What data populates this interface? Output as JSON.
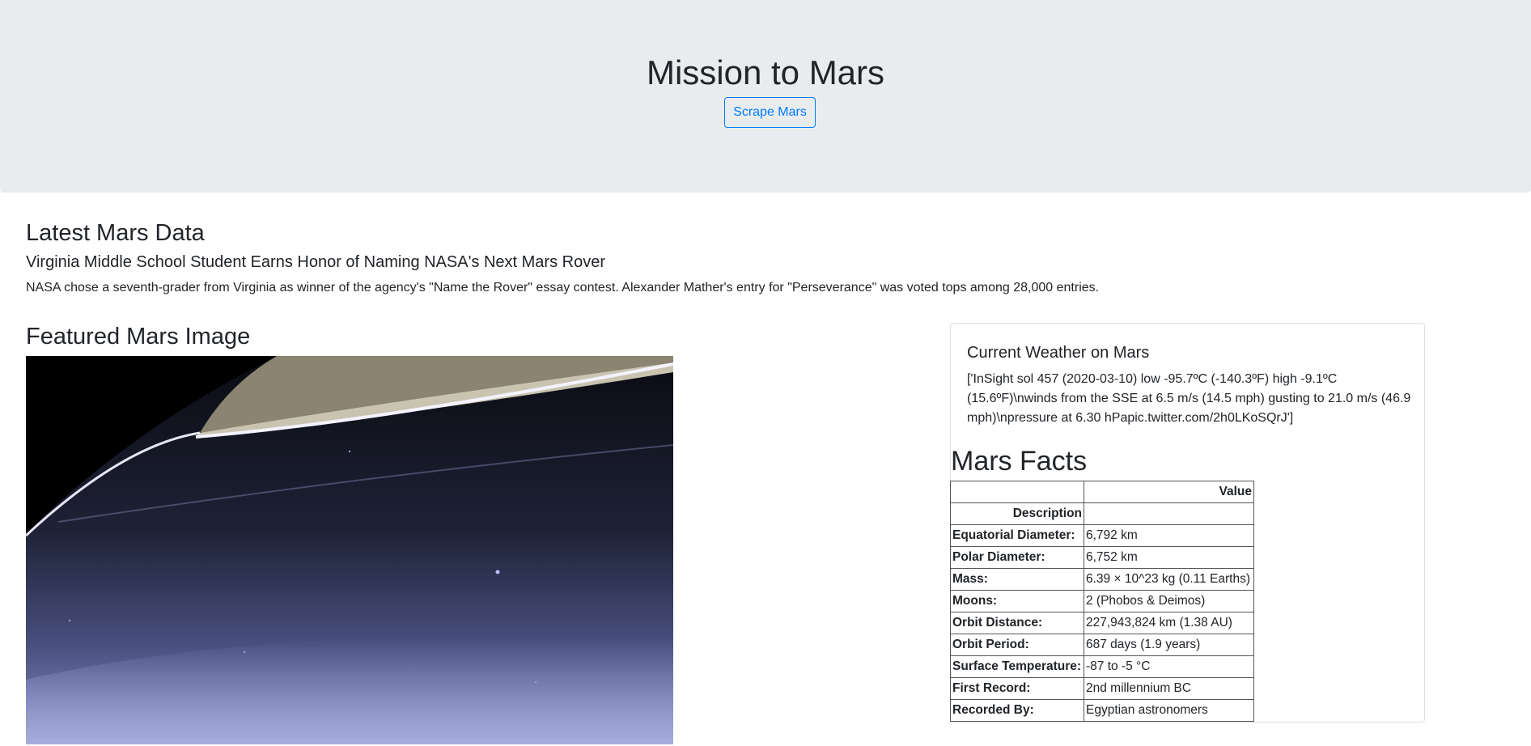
{
  "header": {
    "title": "Mission to Mars",
    "scrape_button": "Scrape Mars"
  },
  "news": {
    "section_title": "Latest Mars Data",
    "headline": "Virginia Middle School Student Earns Honor of Naming NASA's Next Mars Rover",
    "paragraph": "NASA chose a seventh-grader from Virginia as winner of the agency's \"Name the Rover\" essay contest. Alexander Mather's entry for \"Perseverance\" was voted tops among 28,000 entries."
  },
  "featured": {
    "section_title": "Featured Mars Image"
  },
  "weather": {
    "title": "Current Weather on Mars",
    "text": "['InSight sol 457 (2020-03-10) low -95.7ºC (-140.3ºF) high -9.1ºC (15.6ºF)\\nwinds from the SSE at 6.5 m/s (14.5 mph) gusting to 21.0 m/s (46.9 mph)\\npressure at 6.30 hPapic.twitter.com/2h0LKoSQrJ']"
  },
  "facts": {
    "title": "Mars Facts",
    "header_value": "Value",
    "index_name": "Description",
    "rows": [
      {
        "key": "Equatorial Diameter:",
        "value": "6,792 km"
      },
      {
        "key": "Polar Diameter:",
        "value": "6,752 km"
      },
      {
        "key": "Mass:",
        "value": "6.39 × 10^23 kg (0.11 Earths)"
      },
      {
        "key": "Moons:",
        "value": "2 (Phobos & Deimos)"
      },
      {
        "key": "Orbit Distance:",
        "value": "227,943,824 km (1.38 AU)"
      },
      {
        "key": "Orbit Period:",
        "value": "687 days (1.9 years)"
      },
      {
        "key": "Surface Temperature:",
        "value": "-87 to -5 °C"
      },
      {
        "key": "First Record:",
        "value": "2nd millennium BC"
      },
      {
        "key": "Recorded By:",
        "value": "Egyptian astronomers"
      }
    ]
  }
}
